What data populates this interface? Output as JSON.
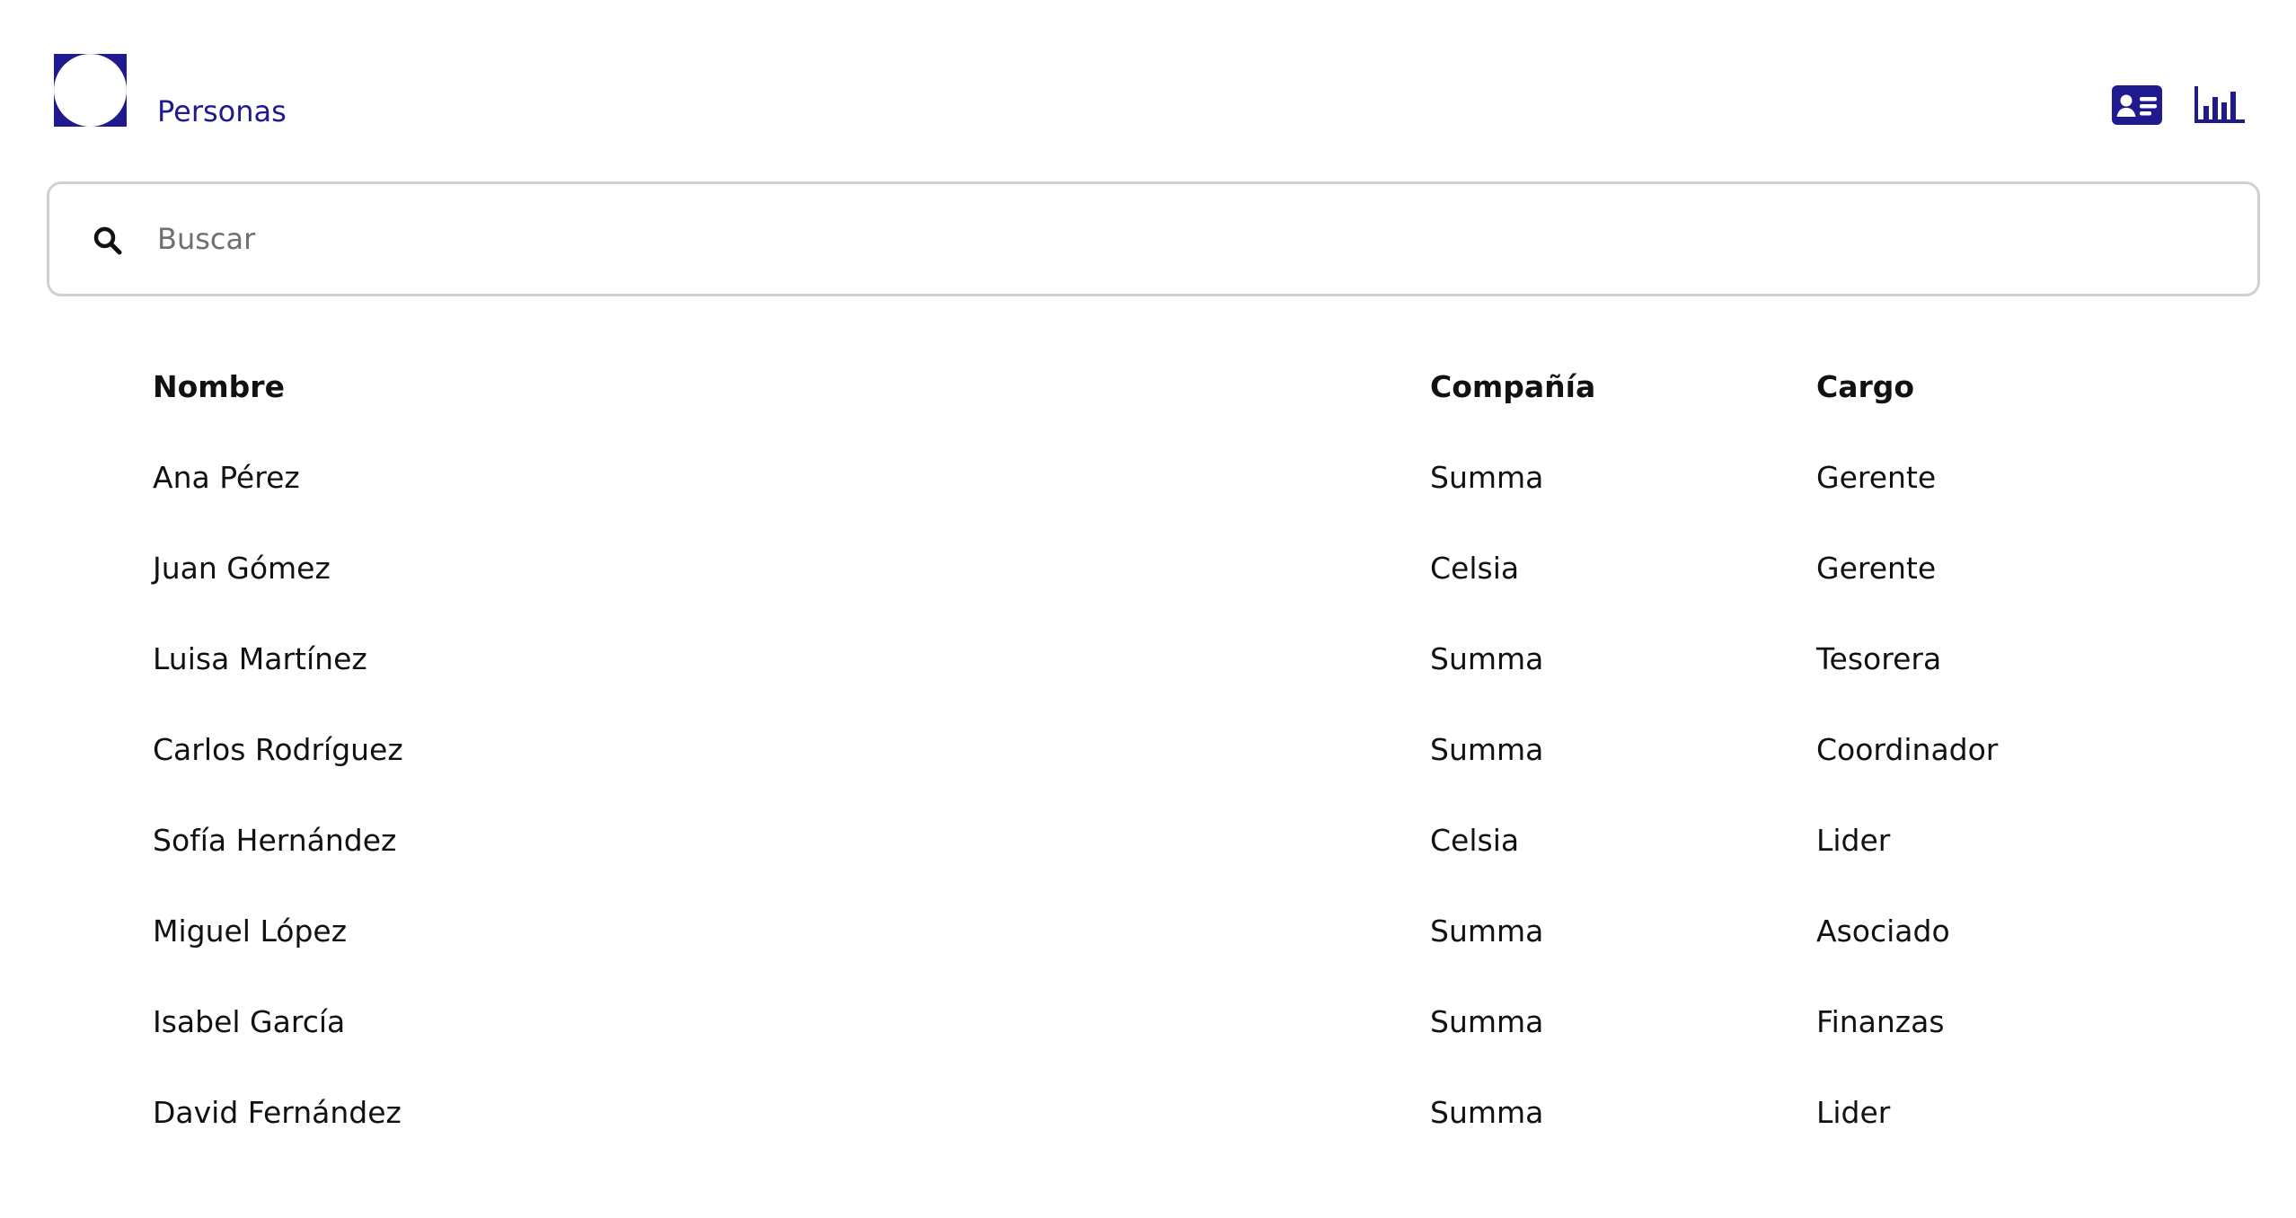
{
  "header": {
    "title": "Personas",
    "icons": [
      "contact-card-icon",
      "bar-chart-icon"
    ],
    "brand_color": "#1f1a8e"
  },
  "search": {
    "placeholder": "Buscar",
    "value": ""
  },
  "table": {
    "columns": [
      "Nombre",
      "Compañía",
      "Cargo"
    ],
    "rows": [
      [
        "Ana Pérez",
        "Summa",
        "Gerente"
      ],
      [
        "Juan Gómez",
        "Celsia",
        "Gerente"
      ],
      [
        "Luisa Martínez",
        "Summa",
        "Tesorera"
      ],
      [
        "Carlos Rodríguez",
        "Summa",
        "Coordinador"
      ],
      [
        "Sofía Hernández",
        "Celsia",
        "Lider"
      ],
      [
        "Miguel López",
        "Summa",
        "Asociado"
      ],
      [
        "Isabel García",
        "Summa",
        "Finanzas"
      ],
      [
        "David Fernández",
        "Summa",
        "Lider"
      ]
    ]
  }
}
